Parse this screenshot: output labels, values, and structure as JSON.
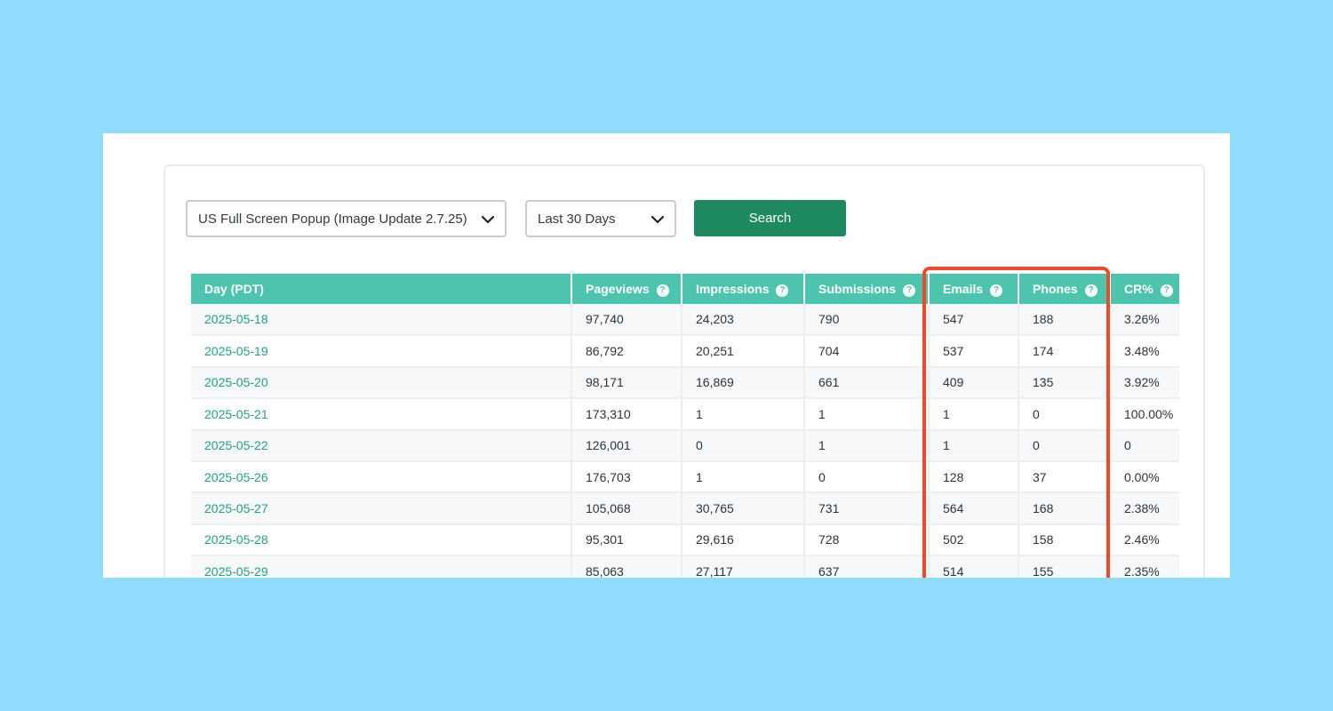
{
  "filters": {
    "popup_select": {
      "value": "US Full Screen Popup (Image Update 2.7.25)"
    },
    "range_select": {
      "value": "Last 30 Days"
    },
    "search_label": "Search"
  },
  "table": {
    "columns": [
      {
        "label": "Day (PDT)",
        "help": false
      },
      {
        "label": "Pageviews",
        "help": true
      },
      {
        "label": "Impressions",
        "help": true
      },
      {
        "label": "Submissions",
        "help": true
      },
      {
        "label": "Emails",
        "help": true
      },
      {
        "label": "Phones",
        "help": true
      },
      {
        "label": "CR%",
        "help": true
      }
    ],
    "help_glyph": "?",
    "rows": [
      [
        "2025-05-18",
        "97,740",
        "24,203",
        "790",
        "547",
        "188",
        "3.26%"
      ],
      [
        "2025-05-19",
        "86,792",
        "20,251",
        "704",
        "537",
        "174",
        "3.48%"
      ],
      [
        "2025-05-20",
        "98,171",
        "16,869",
        "661",
        "409",
        "135",
        "3.92%"
      ],
      [
        "2025-05-21",
        "173,310",
        "1",
        "1",
        "1",
        "0",
        "100.00%"
      ],
      [
        "2025-05-22",
        "126,001",
        "0",
        "1",
        "1",
        "0",
        "0"
      ],
      [
        "2025-05-26",
        "176,703",
        "1",
        "0",
        "128",
        "37",
        "0.00%"
      ],
      [
        "2025-05-27",
        "105,068",
        "30,765",
        "731",
        "564",
        "168",
        "2.38%"
      ],
      [
        "2025-05-28",
        "95,301",
        "29,616",
        "728",
        "502",
        "158",
        "2.46%"
      ],
      [
        "2025-05-29",
        "85,063",
        "27,117",
        "637",
        "514",
        "155",
        "2.35%"
      ]
    ]
  },
  "colors": {
    "background": "#8fdcfc",
    "header": "#4cc4ae",
    "search_button": "#1f8a5f",
    "date_link": "#22a07f",
    "highlight_box": "#ea4b2b"
  },
  "icons": {
    "select_arrow": "chevron-down-icon",
    "column_help": "help-circle-icon"
  }
}
